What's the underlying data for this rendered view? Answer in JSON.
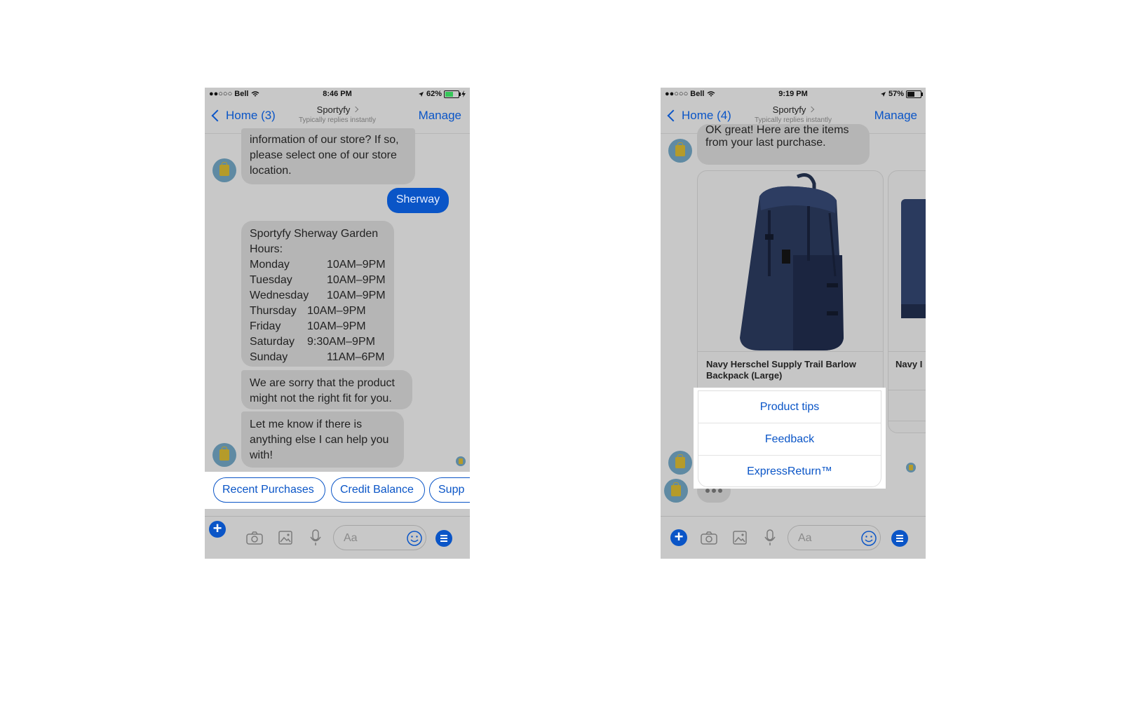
{
  "screens": [
    {
      "status": {
        "carrier": "●●○○○ Bell",
        "time": "8:46 PM",
        "battery": "62%",
        "battery_color": "#35c759"
      },
      "nav": {
        "back": "Home (3)",
        "title": "Sportyfy",
        "subtitle": "Typically replies instantly",
        "manage": "Manage"
      },
      "messages": {
        "store_question": "information of our store? If so, please select one of our store location.",
        "user_reply": "Sherway",
        "hours_title": "Sportyfy Sherway Garden Hours:",
        "hours": [
          {
            "day": "Monday",
            "time": "10AM–9PM"
          },
          {
            "day": "Tuesday",
            "time": "10AM–9PM"
          },
          {
            "day": "Wednesday",
            "time": "10AM–9PM"
          },
          {
            "day": "Thursday",
            "time": "10AM–9PM"
          },
          {
            "day": "Friday",
            "time": "10AM–9PM"
          },
          {
            "day": "Saturday",
            "time": "9:30AM–9PM"
          },
          {
            "day": "Sunday",
            "time": "11AM–6PM"
          }
        ],
        "sorry": "We are sorry that the product might not the right fit for you.",
        "help": "Let me know if there is anything else I can help you with!"
      },
      "quick_replies": [
        "Recent Purchases",
        "Credit Balance",
        "Supp"
      ],
      "composer": {
        "placeholder": "Aa"
      }
    },
    {
      "status": {
        "carrier": "●●○○○ Bell",
        "time": "9:19 PM",
        "battery": "57%",
        "battery_color": "#111111"
      },
      "nav": {
        "back": "Home (4)",
        "title": "Sportyfy",
        "subtitle": "Typically replies instantly",
        "manage": "Manage"
      },
      "messages": {
        "intro_top": "OK great! Here are the items",
        "intro": "from your last purchase."
      },
      "cards": [
        {
          "title": "Navy Herschel Supply Trail Barlow Backpack (Large)"
        },
        {
          "title": "Navy I"
        }
      ],
      "menu": [
        "Product tips",
        "Feedback",
        "ExpressReturn™"
      ],
      "composer": {
        "placeholder": "Aa"
      }
    }
  ]
}
